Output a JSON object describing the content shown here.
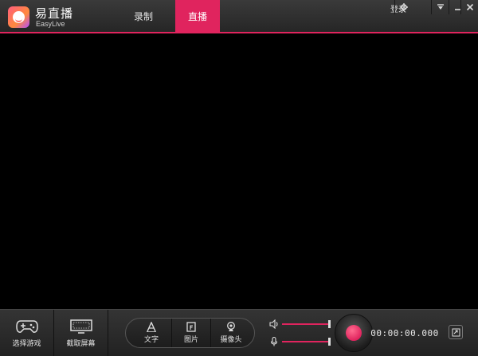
{
  "app": {
    "name": "易直播",
    "subtitle": "EasyLive"
  },
  "tabs": [
    {
      "label": "录制",
      "active": false
    },
    {
      "label": "直播",
      "active": true
    }
  ],
  "header": {
    "login_label": "登录"
  },
  "toolbar": {
    "game_label": "选择游戏",
    "screen_label": "截取屏幕",
    "text_label": "文字",
    "image_label": "图片",
    "camera_label": "摄像头",
    "timer": "00:00:00.000"
  },
  "colors": {
    "accent": "#e0245e",
    "background": "#000000",
    "bar": "#2a2a2a"
  },
  "icons": {
    "settings": "gear-icon",
    "dropdown": "dropdown-icon",
    "minimize": "minimize-icon",
    "close": "close-icon",
    "gamepad": "gamepad-icon",
    "screen": "screen-capture-icon",
    "text": "text-icon",
    "image": "image-icon",
    "camera": "webcam-icon",
    "volume": "speaker-icon",
    "mic": "microphone-icon",
    "share": "share-icon"
  },
  "levels": {
    "speaker_volume": 1.0,
    "microphone_volume": 1.0
  }
}
